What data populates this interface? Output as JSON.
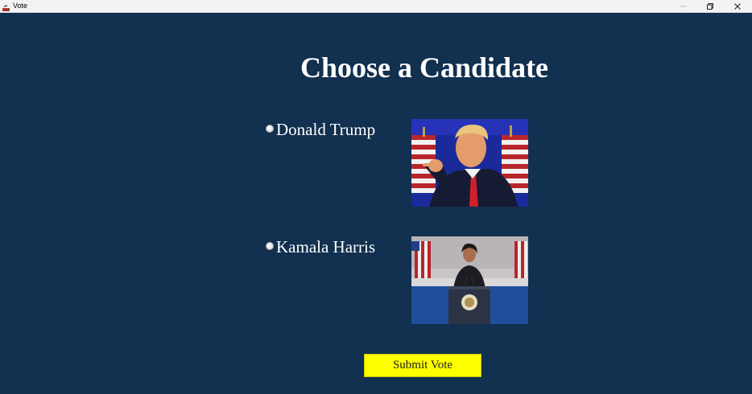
{
  "window": {
    "title": "Vote",
    "icons": {
      "app": "java-app-icon",
      "minimize": "minimize-icon",
      "restore": "restore-icon",
      "close": "close-icon"
    }
  },
  "page": {
    "heading": "Choose a Candidate",
    "candidates": [
      {
        "label": "Donald Trump",
        "selected": false,
        "photo": "candidate-photo-trump"
      },
      {
        "label": "Kamala Harris",
        "selected": false,
        "photo": "candidate-photo-harris"
      }
    ],
    "submit_label": "Submit Vote"
  },
  "colors": {
    "background": "#12304f",
    "heading_text": "#ffffff",
    "submit_background": "#ffff00",
    "titlebar": "#f3f3f3"
  }
}
